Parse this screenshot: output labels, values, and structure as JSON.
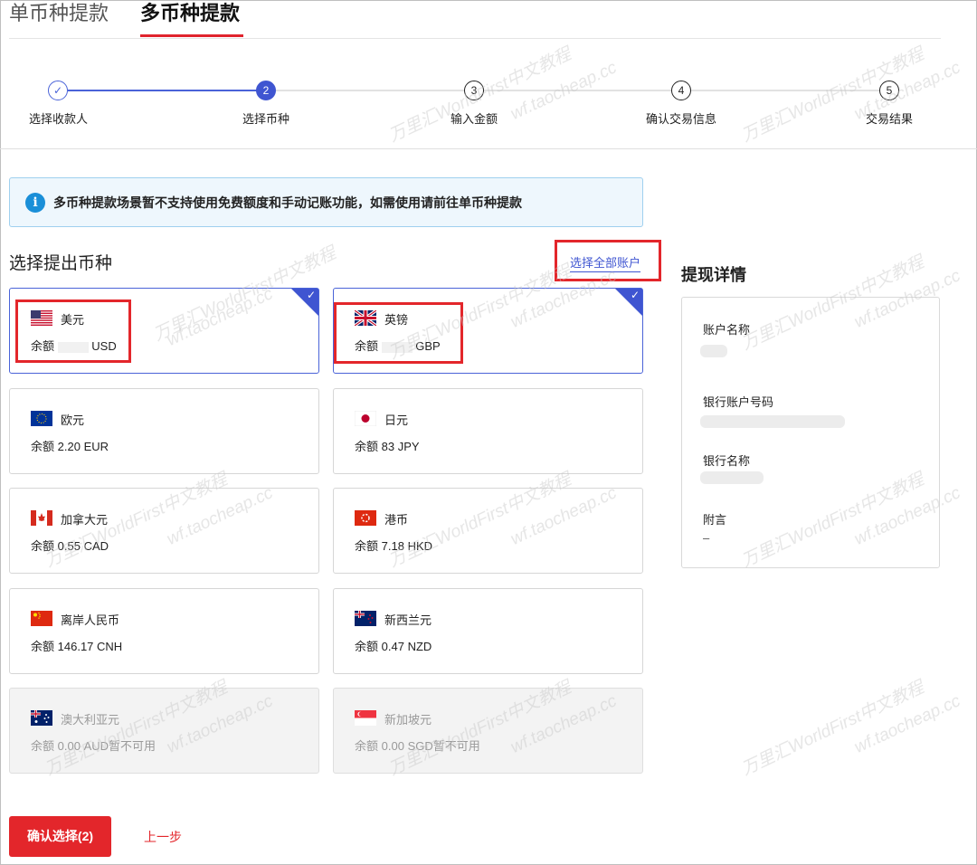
{
  "tabs": {
    "single": "单币种提款",
    "multi": "多币种提款"
  },
  "steps": [
    {
      "num": "✓",
      "label": "选择收款人",
      "state": "done"
    },
    {
      "num": "2",
      "label": "选择币种",
      "state": "active"
    },
    {
      "num": "3",
      "label": "输入金额",
      "state": "todo"
    },
    {
      "num": "4",
      "label": "确认交易信息",
      "state": "todo"
    },
    {
      "num": "5",
      "label": "交易结果",
      "state": "todo"
    }
  ],
  "banner": {
    "icon": "info-icon",
    "text": "多币种提款场景暂不支持使用免费额度和手动记账功能，如需使用请前往单币种提款"
  },
  "section": {
    "title": "选择提出币种",
    "select_all": "选择全部账户"
  },
  "currencies": [
    {
      "name": "美元",
      "balance_label": "余额",
      "amount": "",
      "code": "USD",
      "suffix": "",
      "flag": "us-flag",
      "selected": true
    },
    {
      "name": "英镑",
      "balance_label": "余额",
      "amount": "",
      "code": "GBP",
      "suffix": "",
      "flag": "uk-flag",
      "selected": true
    },
    {
      "name": "欧元",
      "balance_label": "余额",
      "amount": "2.20",
      "code": "EUR",
      "suffix": "",
      "flag": "eu-flag"
    },
    {
      "name": "日元",
      "balance_label": "余额",
      "amount": "83",
      "code": "JPY",
      "suffix": "",
      "flag": "jp-flag"
    },
    {
      "name": "加拿大元",
      "balance_label": "余额",
      "amount": "0.55",
      "code": "CAD",
      "suffix": "",
      "flag": "ca-flag"
    },
    {
      "name": "港币",
      "balance_label": "余额",
      "amount": "7.18",
      "code": "HKD",
      "suffix": "",
      "flag": "hk-flag"
    },
    {
      "name": "离岸人民币",
      "balance_label": "余额",
      "amount": "146.17",
      "code": "CNH",
      "suffix": "",
      "flag": "cn-flag"
    },
    {
      "name": "新西兰元",
      "balance_label": "余额",
      "amount": "0.47",
      "code": "NZD",
      "suffix": "",
      "flag": "nz-flag"
    },
    {
      "name": "澳大利亚元",
      "balance_label": "余额",
      "amount": "0.00",
      "code": "AUD",
      "suffix": "暂不可用",
      "flag": "au-flag",
      "disabled": true
    },
    {
      "name": "新加坡元",
      "balance_label": "余额",
      "amount": "0.00",
      "code": "SGD",
      "suffix": "暂不可用",
      "flag": "sg-flag",
      "disabled": true
    }
  ],
  "details": {
    "title": "提现详情",
    "account_name_label": "账户名称",
    "bank_account_label": "银行账户号码",
    "bank_name_label": "银行名称",
    "note_label": "附言",
    "note_value": "–"
  },
  "actions": {
    "confirm": "确认选择(2)",
    "back": "上一步"
  },
  "watermark": {
    "line1": "万里汇WorldFirst中文教程",
    "line2": "wf.taocheap.cc"
  },
  "colors": {
    "accent": "#e3262b",
    "primary": "#3f55d1"
  }
}
